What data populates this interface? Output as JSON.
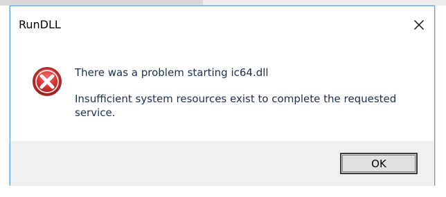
{
  "window": {
    "title": "RunDLL"
  },
  "message": {
    "main": "There was a problem starting ic64.dll",
    "detail": "Insufficient system resources exist to complete the requested service."
  },
  "footer": {
    "ok_label": "OK"
  },
  "icons": {
    "close": "close-icon",
    "error": "error-icon"
  },
  "colors": {
    "accent_border": "#5a9fd6",
    "error_red": "#d32f2f",
    "text": "#1b2f52"
  }
}
